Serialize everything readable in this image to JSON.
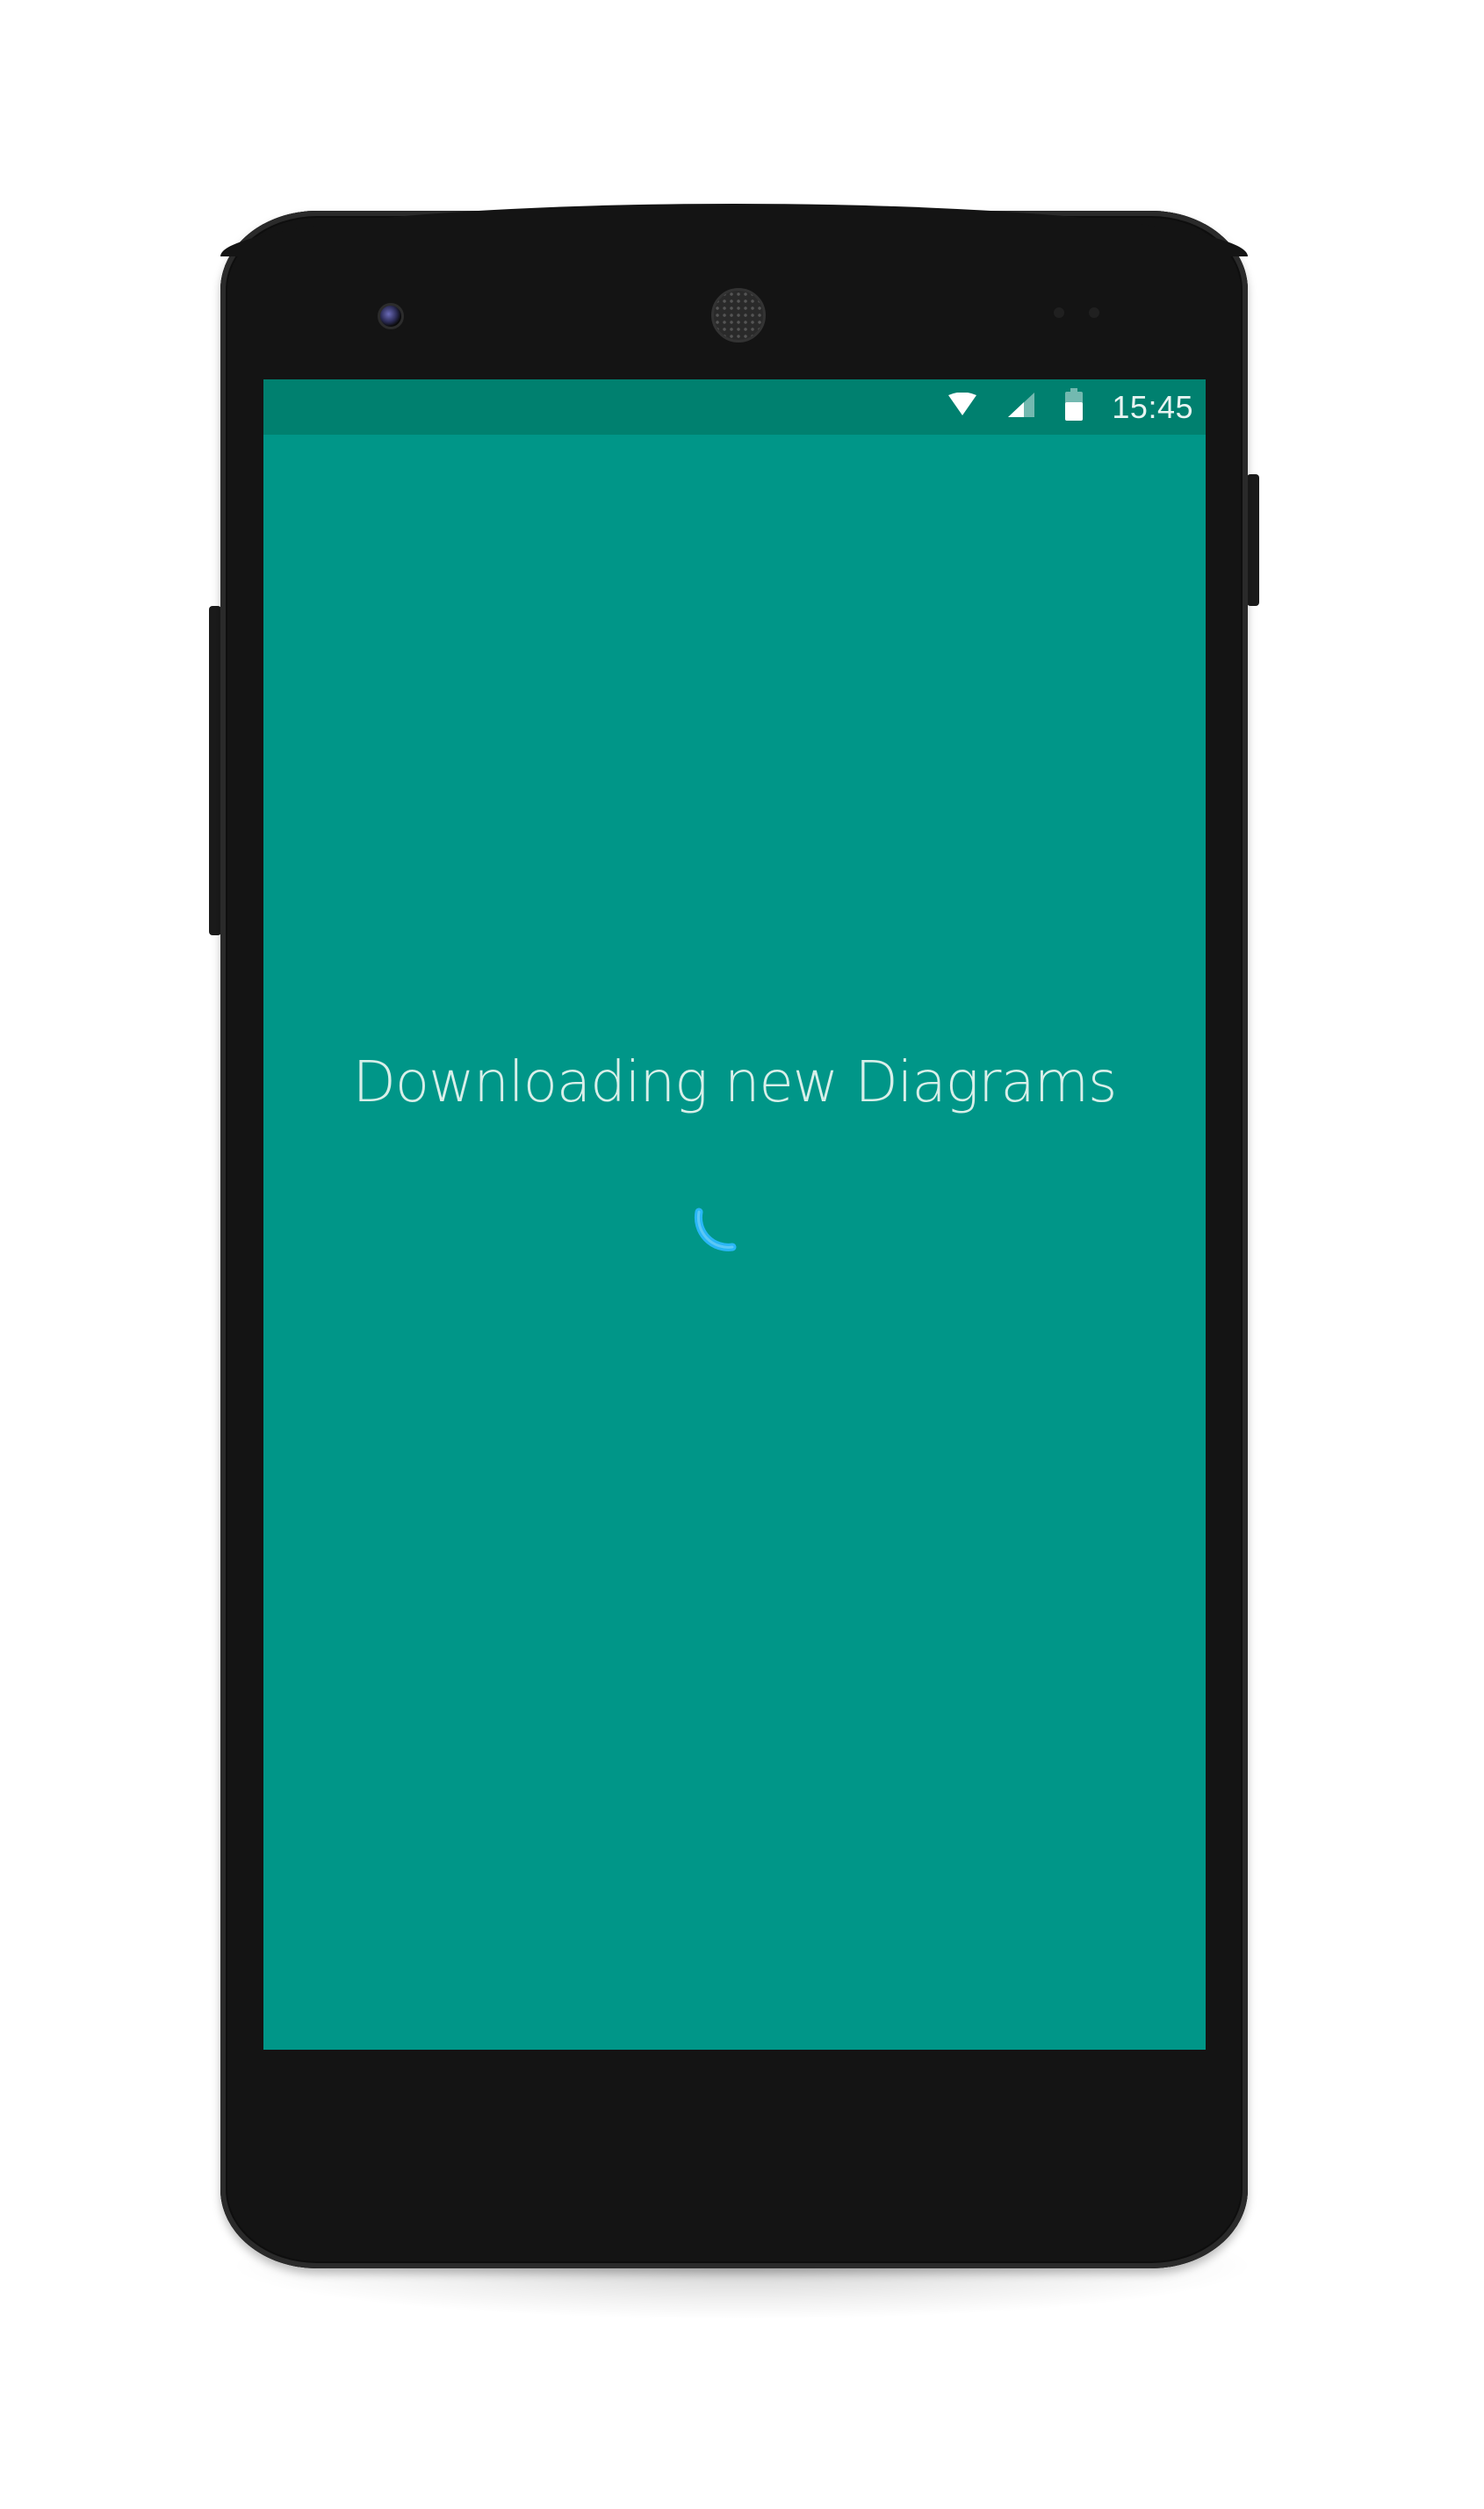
{
  "status_bar": {
    "time": "15:45",
    "icons": [
      "wifi-icon",
      "cellular-signal-icon",
      "battery-icon"
    ]
  },
  "main": {
    "loading_message": "Downloading new Diagrams",
    "spinner": "loading-spinner-icon"
  },
  "colors": {
    "screen_background": "#009688",
    "status_bar_background": "#00806f",
    "spinner_color": "#29b6f6",
    "device_body": "#141414"
  }
}
